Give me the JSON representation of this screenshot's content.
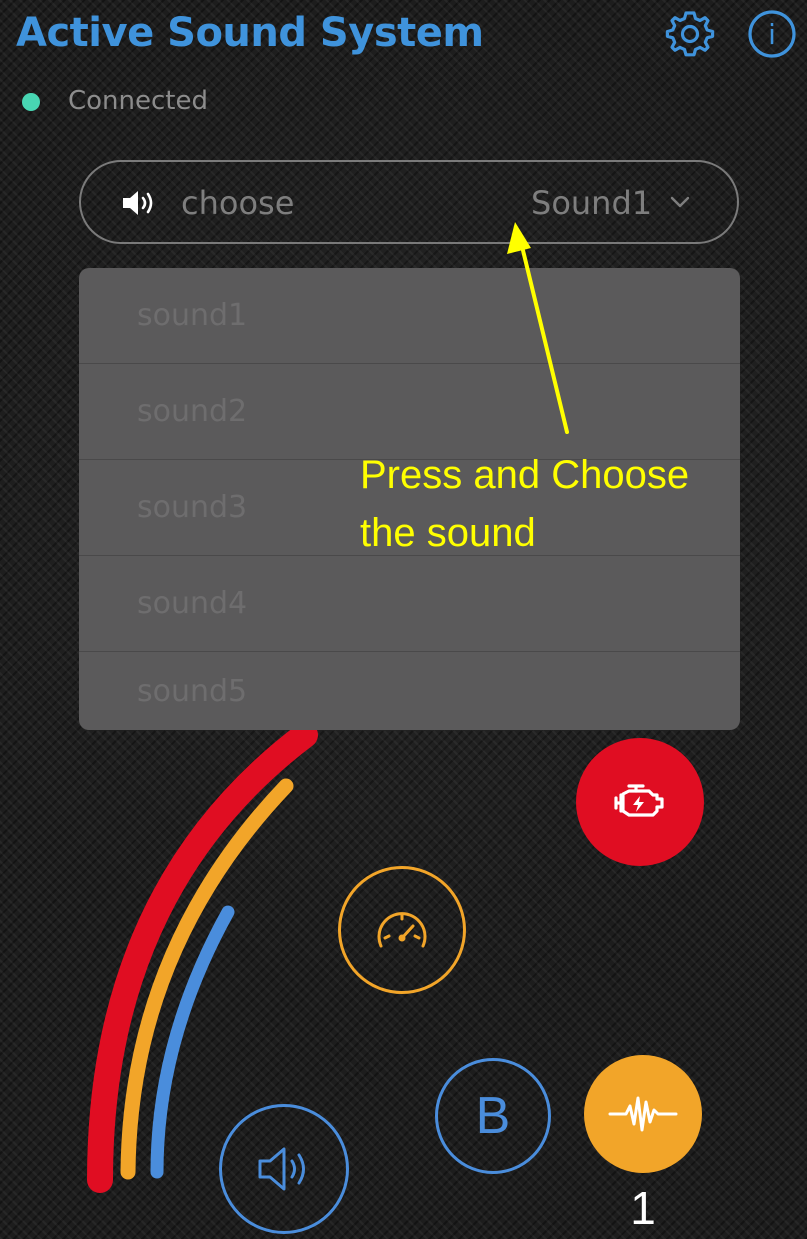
{
  "header": {
    "title": "Active Sound System",
    "settings_icon": "gear-icon",
    "info_icon": "info-icon",
    "info_glyph": "i"
  },
  "status": {
    "text": "Connected"
  },
  "sound_select": {
    "label": "choose",
    "value": "Sound1",
    "icon": "speaker-icon",
    "options": [
      "sound1",
      "sound2",
      "sound3",
      "sound4",
      "sound5"
    ]
  },
  "annotation": {
    "line1": "Press and Choose",
    "line2": "the sound"
  },
  "controls": {
    "b_label": "B",
    "mode_number": "1"
  },
  "colors": {
    "title": "#3f93dc",
    "status_dot": "#48d6b3",
    "accent_red": "#e00d22",
    "accent_orange": "#f2a529",
    "accent_blue": "#4a8ddc",
    "annotation": "#ffff00",
    "white": "#ffffff"
  }
}
